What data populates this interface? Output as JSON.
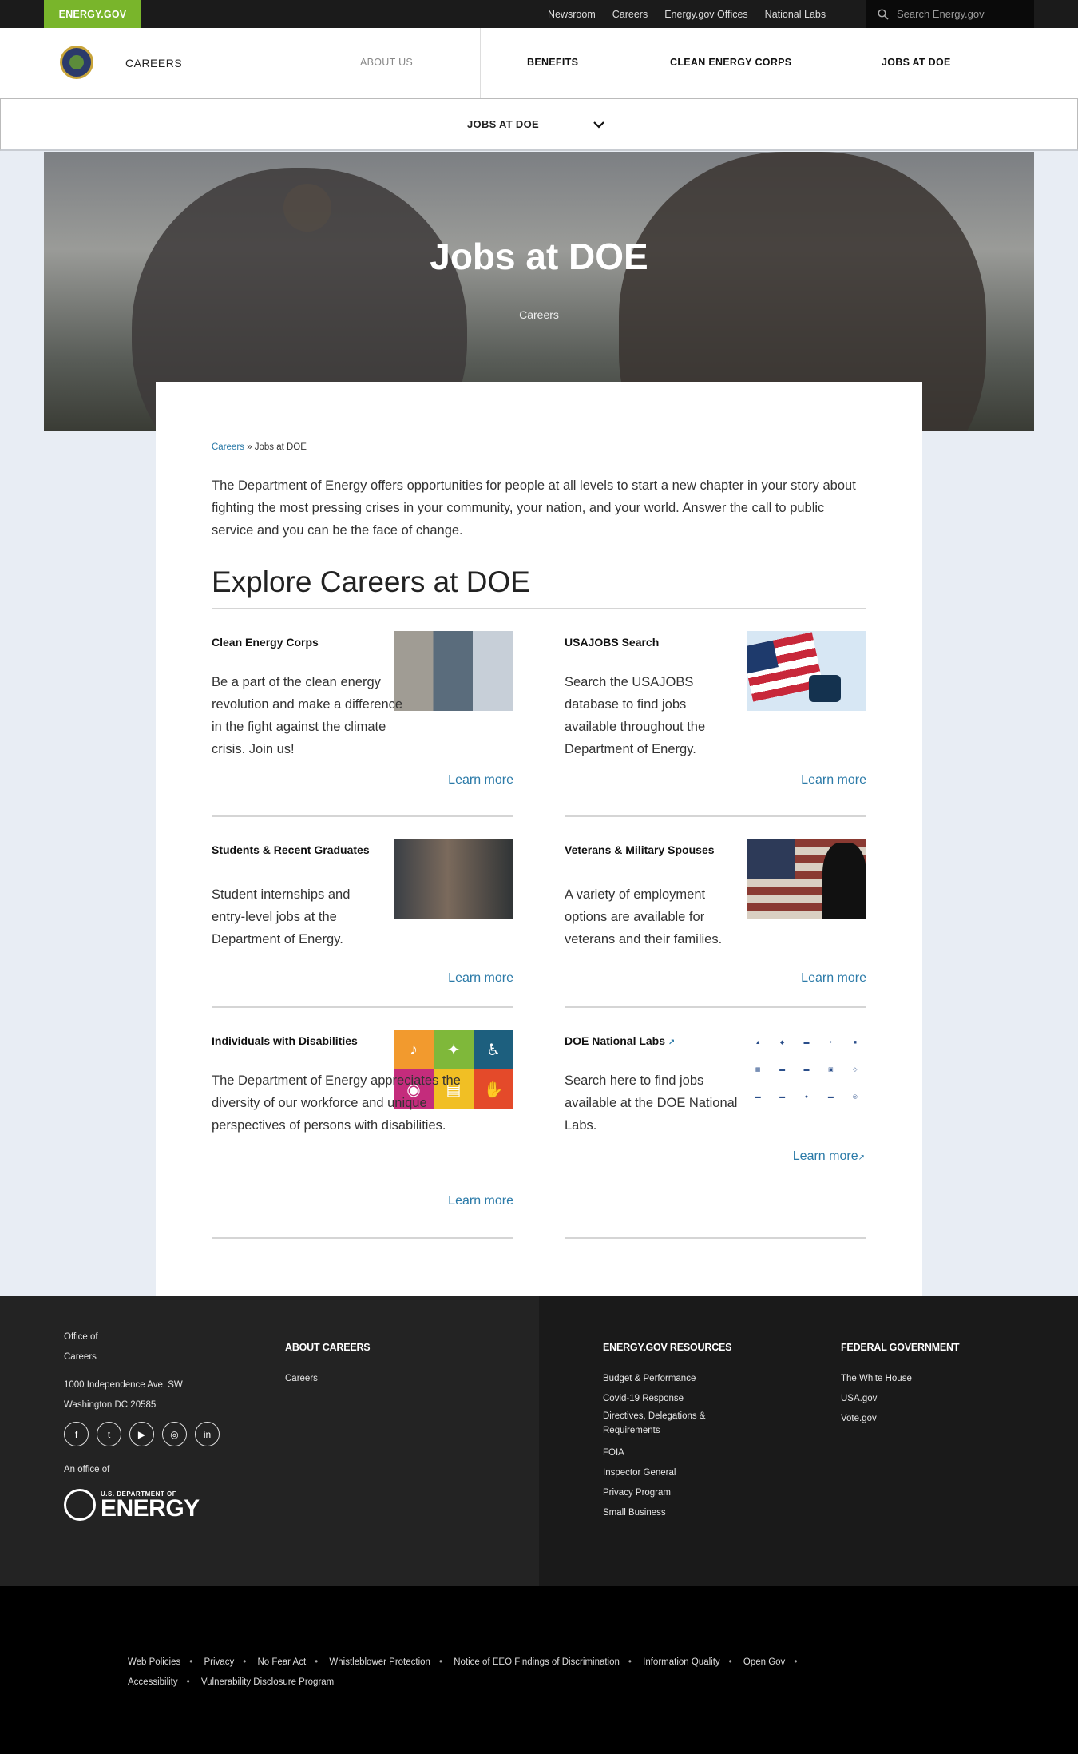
{
  "topbar": {
    "brand": "ENERGY.GOV",
    "links": [
      "Newsroom",
      "Careers",
      "Energy.gov Offices",
      "National Labs"
    ],
    "search_placeholder": "Search Energy.gov"
  },
  "nav": {
    "site_name": "CAREERS",
    "items": [
      "ABOUT US",
      "BENEFITS",
      "CLEAN ENERGY CORPS",
      "JOBS AT DOE"
    ]
  },
  "subnav": {
    "label": "JOBS AT DOE"
  },
  "hero": {
    "title": "Jobs at DOE",
    "subtitle": "Careers"
  },
  "breadcrumb": {
    "link": "Careers",
    "sep": "»",
    "current": "Jobs at DOE"
  },
  "intro": "The Department of Energy offers opportunities for people at all levels to start a new chapter in your story about fighting the most pressing crises in your community, your nation, and your world. Answer the call to public service and you can be the face of change.",
  "section_title": "Explore Careers at DOE",
  "cards": [
    {
      "title": "Clean Energy Corps",
      "desc": "Be a part of the clean energy revolution and make a difference in the fight against the climate crisis. Join us!",
      "link": "Learn more"
    },
    {
      "title": "USAJOBS Search",
      "desc": "Search the USAJOBS database to find jobs available throughout the Department of Energy.",
      "link": "Learn more"
    },
    {
      "title": "Students & Recent Graduates",
      "desc": "Student internships and entry-level jobs at the Department of Energy.",
      "link": "Learn more"
    },
    {
      "title": "Veterans & Military Spouses",
      "desc": "A variety of employment options are available for veterans and their families.",
      "link": "Learn more"
    },
    {
      "title": "Individuals with Disabilities",
      "desc": "The Department of Energy appreciates the diversity of our workforce and unique perspectives of persons with disabilities.",
      "link": "Learn more"
    },
    {
      "title": "DOE National Labs",
      "desc": "Search here to find jobs available at the DOE National Labs.",
      "link": "Learn more"
    }
  ],
  "footer": {
    "office": [
      "Office of",
      "Careers"
    ],
    "address": [
      "1000 Independence Ave. SW",
      "Washington DC 20585"
    ],
    "an_office_of": "An office of",
    "logo_small": "U.S. DEPARTMENT OF",
    "logo_big": "ENERGY",
    "col1": {
      "heading": "ABOUT CAREERS",
      "links": [
        "Careers"
      ]
    },
    "col2": {
      "heading": "ENERGY.GOV RESOURCES",
      "links": [
        "Budget & Performance",
        "Covid-19 Response",
        "Directives, Delegations & Requirements",
        "FOIA",
        "Inspector General",
        "Privacy Program",
        "Small Business"
      ]
    },
    "col3": {
      "heading": "FEDERAL GOVERNMENT",
      "links": [
        "The White House",
        "USA.gov",
        "Vote.gov"
      ]
    }
  },
  "bottom_links": [
    "Web Policies",
    "Privacy",
    "No Fear Act",
    "Whistleblower Protection",
    "Notice of EEO Findings of Discrimination",
    "Information Quality",
    "Open Gov",
    "Accessibility",
    "Vulnerability Disclosure Program"
  ],
  "icons": {
    "search": "search-icon",
    "chevron": "chevron-down-icon",
    "external": "external-link-icon",
    "social": [
      "facebook-icon",
      "twitter-icon",
      "youtube-icon",
      "instagram-icon",
      "linkedin-icon"
    ]
  },
  "colors": {
    "brand_green": "#79b52b",
    "link_blue": "#2b7aa8",
    "dark": "#1b1b1b"
  }
}
